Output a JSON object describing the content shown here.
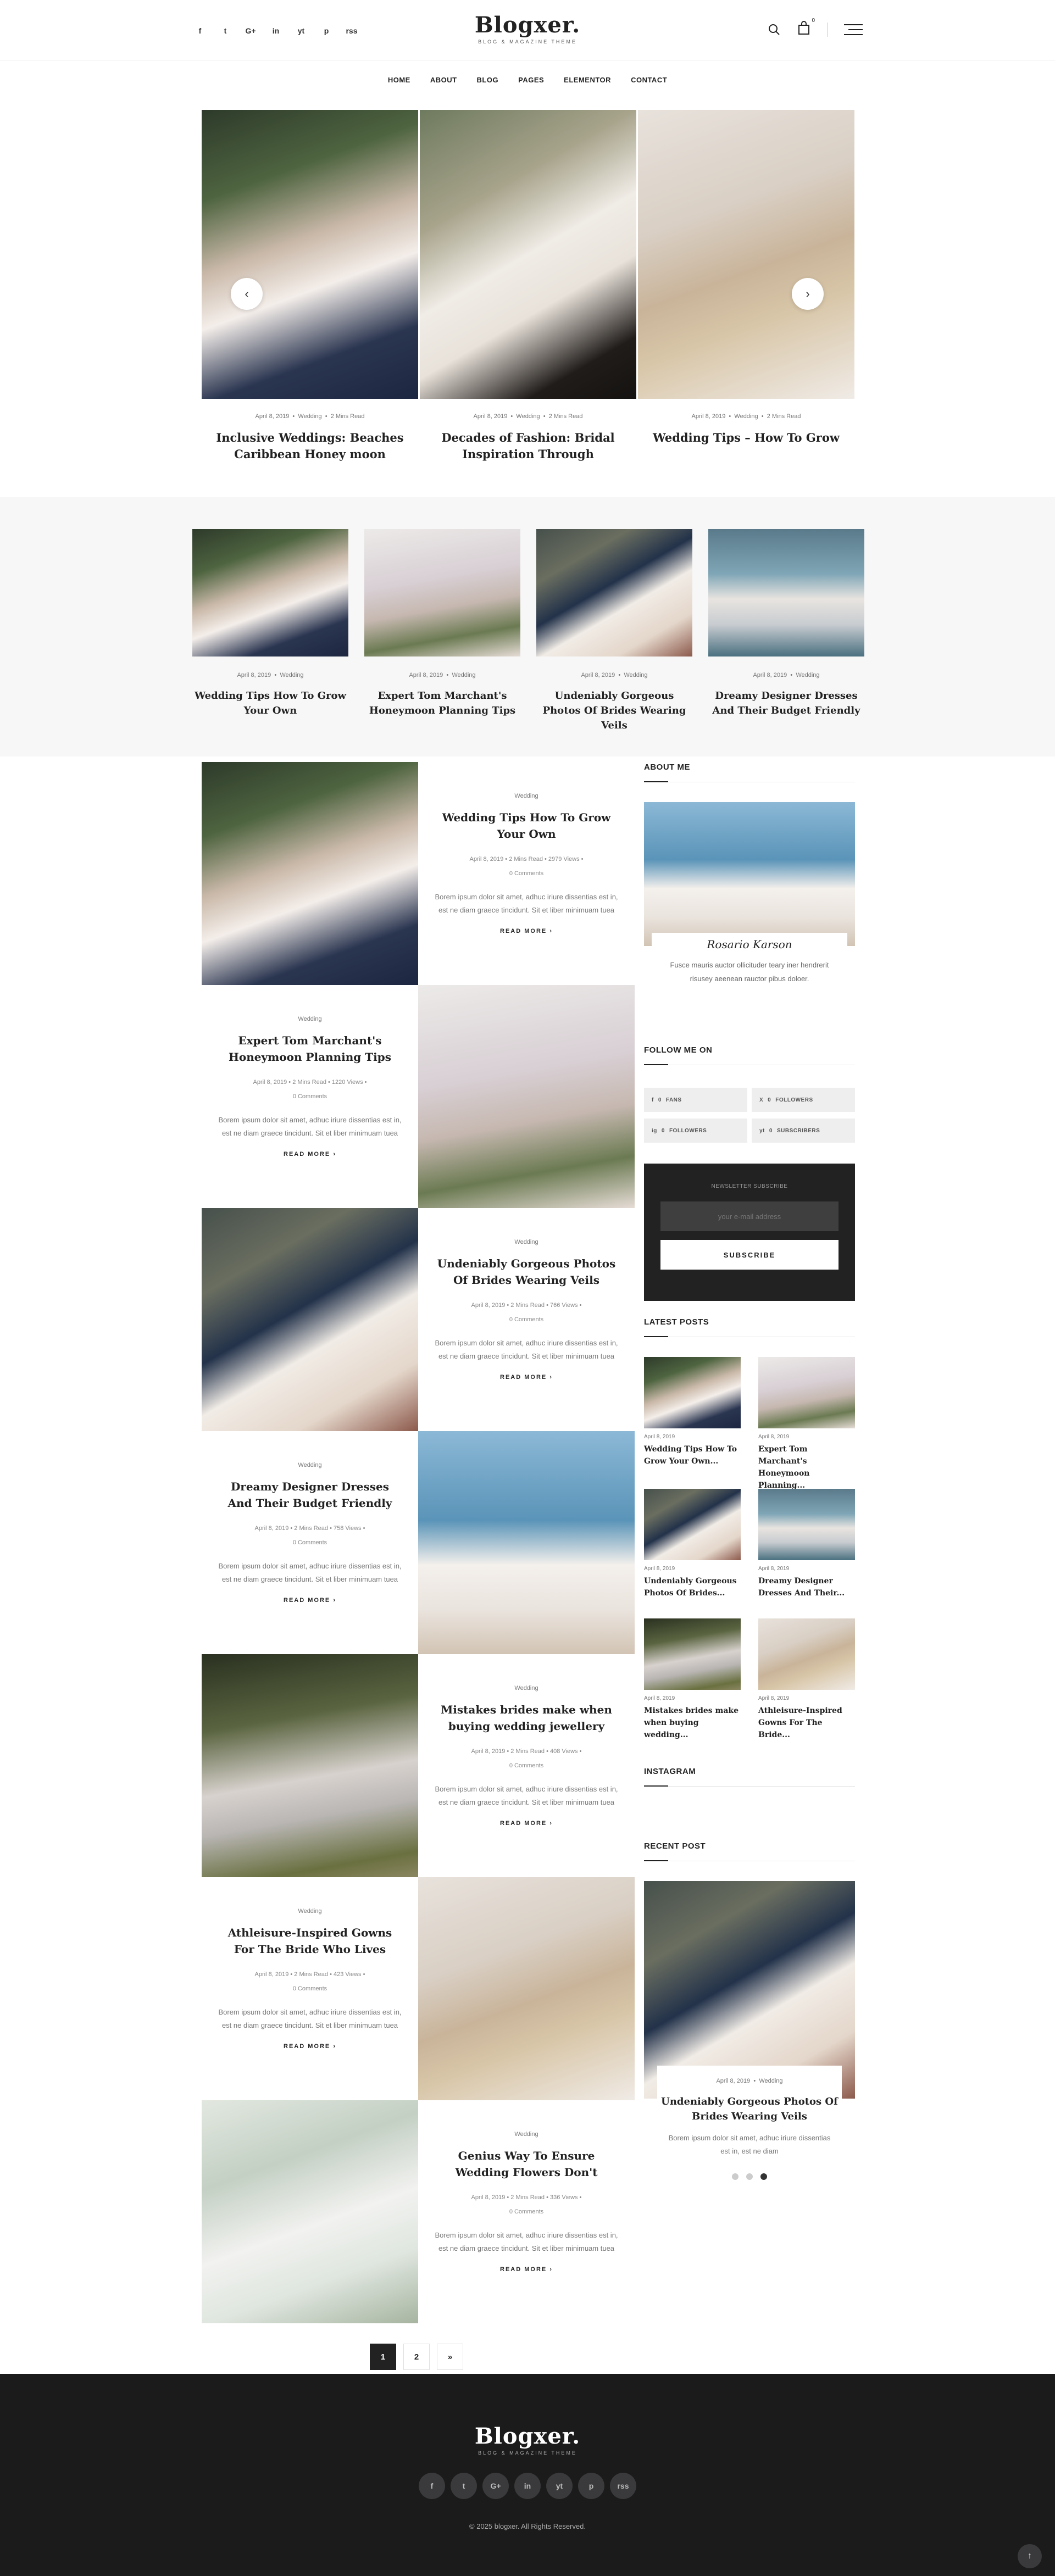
{
  "header": {
    "brand": "Blogxer.",
    "tagline": "BLOG & MAGAZINE THEME",
    "social": [
      "f",
      "t",
      "G+",
      "in",
      "yt",
      "p",
      "rss"
    ],
    "cart_count": "0"
  },
  "nav": [
    "HOME",
    "ABOUT",
    "BLOG",
    "PAGES",
    "ELEMENTOR",
    "CONTACT"
  ],
  "slider": [
    {
      "date": "April 8, 2019",
      "cat": "Wedding",
      "read": "2 Mins Read",
      "title": "Inclusive Weddings: Beaches Caribbean Honey moon"
    },
    {
      "date": "April 8, 2019",
      "cat": "Wedding",
      "read": "2 Mins Read",
      "title": "Decades of Fashion: Bridal Inspiration Through"
    },
    {
      "date": "April 8, 2019",
      "cat": "Wedding",
      "read": "2 Mins Read",
      "title": "Wedding Tips – How To Grow"
    }
  ],
  "band": [
    {
      "date": "April 8, 2019",
      "cat": "Wedding",
      "title": "Wedding Tips How To Grow Your Own"
    },
    {
      "date": "April 8, 2019",
      "cat": "Wedding",
      "title": "Expert Tom Marchant's Honeymoon Planning Tips"
    },
    {
      "date": "April 8, 2019",
      "cat": "Wedding",
      "title": "Undeniably Gorgeous Photos Of Brides Wearing Veils"
    },
    {
      "date": "April 8, 2019",
      "cat": "Wedding",
      "title": "Dreamy Designer Dresses And Their Budget Friendly"
    }
  ],
  "posts": [
    {
      "cat": "Wedding",
      "title": "Wedding Tips How To Grow Your Own",
      "meta1": "April 8, 2019  •  2 Mins Read  •  2979 Views  •",
      "meta2": "0 Comments",
      "excerpt": "Borem ipsum dolor sit amet, adhuc iriure dissentias est in, est ne diam graece tincidunt. Sit et liber minimuam tuea",
      "more": "READ MORE"
    },
    {
      "cat": "Wedding",
      "title": "Expert Tom Marchant's Honeymoon Planning Tips",
      "meta1": "April 8, 2019  •  2 Mins Read  •  1220 Views  •",
      "meta2": "0 Comments",
      "excerpt": "Borem ipsum dolor sit amet, adhuc iriure dissentias est in, est ne diam graece tincidunt. Sit et liber minimuam tuea",
      "more": "READ MORE"
    },
    {
      "cat": "Wedding",
      "title": "Undeniably Gorgeous Photos Of Brides Wearing Veils",
      "meta1": "April 8, 2019  •  2 Mins Read  •  766 Views  •",
      "meta2": "0 Comments",
      "excerpt": "Borem ipsum dolor sit amet, adhuc iriure dissentias est in, est ne diam graece tincidunt. Sit et liber minimuam tuea",
      "more": "READ MORE"
    },
    {
      "cat": "Wedding",
      "title": "Dreamy Designer Dresses And Their Budget Friendly",
      "meta1": "April 8, 2019  •  2 Mins Read  •  758 Views  •",
      "meta2": "0 Comments",
      "excerpt": "Borem ipsum dolor sit amet, adhuc iriure dissentias est in, est ne diam graece tincidunt. Sit et liber minimuam tuea",
      "more": "READ MORE"
    },
    {
      "cat": "Wedding",
      "title": "Mistakes brides make when buying wedding jewellery",
      "meta1": "April 8, 2019  •  2 Mins Read  •  408 Views  •",
      "meta2": "0 Comments",
      "excerpt": "Borem ipsum dolor sit amet, adhuc iriure dissentias est in, est ne diam graece tincidunt. Sit et liber minimuam tuea",
      "more": "READ MORE"
    },
    {
      "cat": "Wedding",
      "title": "Athleisure-Inspired Gowns For The Bride Who Lives",
      "meta1": "April 8, 2019  •  2 Mins Read  •  423 Views  •",
      "meta2": "0 Comments",
      "excerpt": "Borem ipsum dolor sit amet, adhuc iriure dissentias est in, est ne diam graece tincidunt. Sit et liber minimuam tuea",
      "more": "READ MORE"
    },
    {
      "cat": "Wedding",
      "title": "Genius Way To Ensure Wedding Flowers Don't",
      "meta1": "April 8, 2019  •  2 Mins Read  •  336 Views  •",
      "meta2": "0 Comments",
      "excerpt": "Borem ipsum dolor sit amet, adhuc iriure dissentias est in, est ne diam graece tincidunt. Sit et liber minimuam tuea",
      "more": "READ MORE"
    }
  ],
  "sidebar": {
    "about_title": "ABOUT ME",
    "about_name": "Rosario Karson",
    "about_text": "Fusce mauris auctor ollicituder teary iner hendrerit risusey aeenean rauctor pibus doloer.",
    "follow_title": "FOLLOW ME ON",
    "follow": [
      {
        "icon": "f",
        "count": "0",
        "label": "FANS"
      },
      {
        "icon": "X",
        "count": "0",
        "label": "FOLLOWERS"
      },
      {
        "icon": "ig",
        "count": "0",
        "label": "FOLLOWERS"
      },
      {
        "icon": "yt",
        "count": "0",
        "label": "SUBSCRIBERS"
      }
    ],
    "newsletter_label": "NEWSLETTER SUBSCRIBE",
    "newsletter_placeholder": "your e-mail address",
    "subscribe": "SUBSCRIBE",
    "latest_title": "LATEST POSTS",
    "latest": [
      {
        "date": "April 8, 2019",
        "title": "Wedding Tips How To Grow Your Own..."
      },
      {
        "date": "April 8, 2019",
        "title": "Expert Tom Marchant's Honeymoon Planning..."
      },
      {
        "date": "April 8, 2019",
        "title": "Undeniably Gorgeous Photos Of Brides..."
      },
      {
        "date": "April 8, 2019",
        "title": "Dreamy Designer Dresses And Their..."
      },
      {
        "date": "April 8, 2019",
        "title": "Mistakes brides make when buying wedding..."
      },
      {
        "date": "April 8, 2019",
        "title": "Athleisure-Inspired Gowns For The Bride..."
      }
    ],
    "instagram_title": "INSTAGRAM",
    "recent_title": "RECENT POST",
    "recent": {
      "date": "April 8, 2019",
      "cat": "Wedding",
      "title": "Undeniably Gorgeous Photos Of Brides Wearing Veils",
      "excerpt": "Borem ipsum dolor sit amet, adhuc iriure dissentias est in, est ne diam"
    }
  },
  "pagination": [
    "1",
    "2",
    "»"
  ],
  "footer": {
    "brand": "Blogxer.",
    "tagline": "BLOG & MAGAZINE THEME",
    "social": [
      "f",
      "t",
      "G+",
      "in",
      "yt",
      "p",
      "rss"
    ],
    "copyright": "© 2025 blogxer. All Rights Reserved."
  },
  "colors": {
    "accent": "#222222",
    "footer_bg": "#1b1b1c",
    "band_bg": "#f7f7f7"
  }
}
